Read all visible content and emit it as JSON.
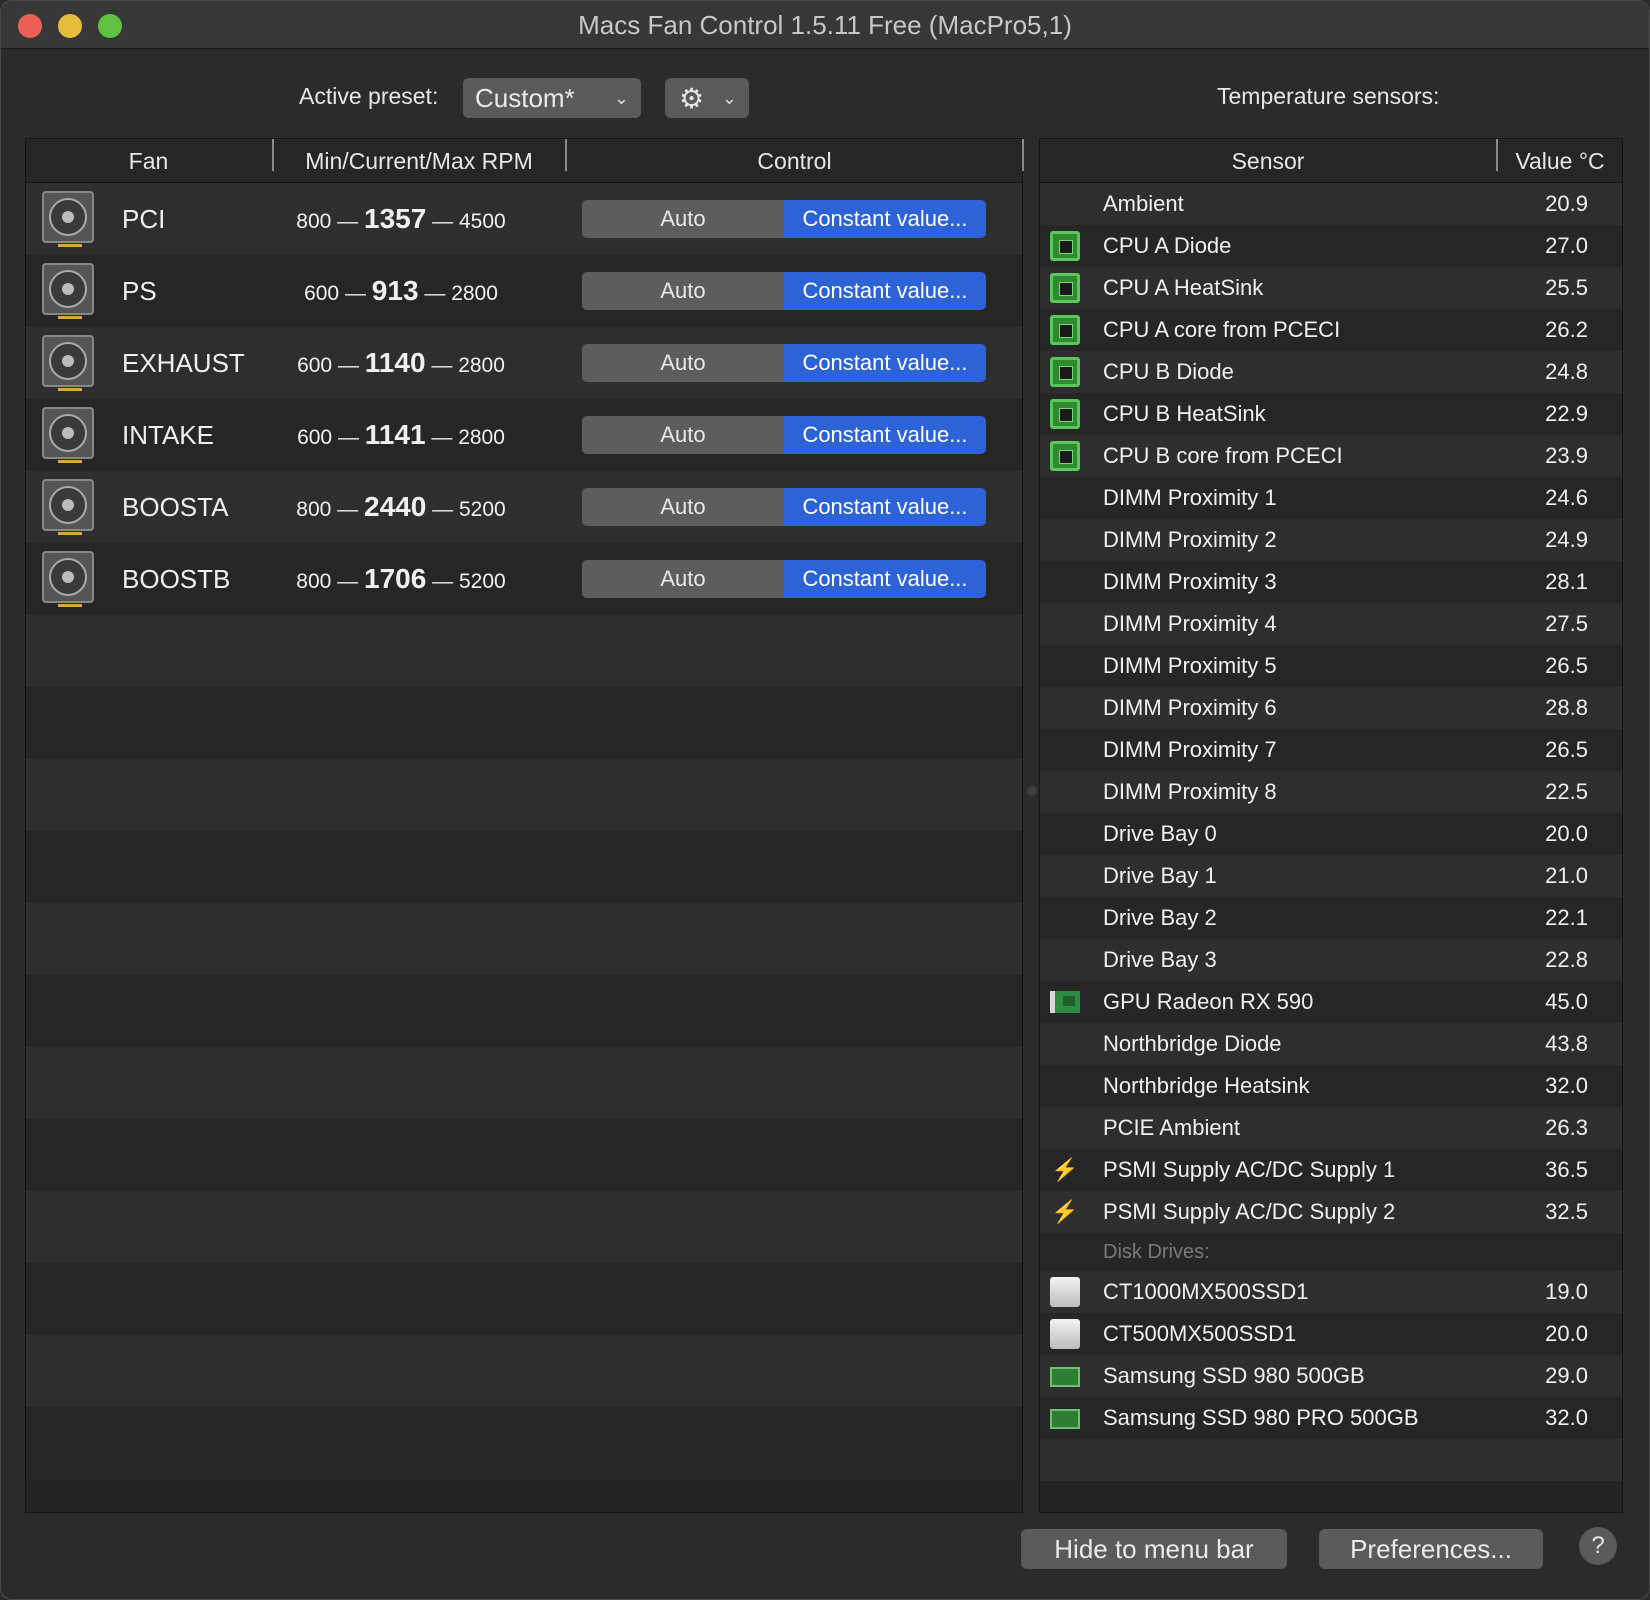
{
  "window": {
    "title": "Macs Fan Control 1.5.11 Free (MacPro5,1)"
  },
  "toolbar": {
    "preset_label": "Active preset:",
    "preset_value": "Custom*",
    "temperature_title": "Temperature sensors:"
  },
  "fans": {
    "headers": {
      "fan": "Fan",
      "rpm": "Min/Current/Max RPM",
      "control": "Control"
    },
    "rows": [
      {
        "name": "PCI",
        "min": "800",
        "current": "1357",
        "max": "4500",
        "auto": "Auto",
        "constant": "Constant value..."
      },
      {
        "name": "PS",
        "min": "600",
        "current": "913",
        "max": "2800",
        "auto": "Auto",
        "constant": "Constant value..."
      },
      {
        "name": "EXHAUST",
        "min": "600",
        "current": "1140",
        "max": "2800",
        "auto": "Auto",
        "constant": "Constant value..."
      },
      {
        "name": "INTAKE",
        "min": "600",
        "current": "1141",
        "max": "2800",
        "auto": "Auto",
        "constant": "Constant value..."
      },
      {
        "name": "BOOSTA",
        "min": "800",
        "current": "2440",
        "max": "5200",
        "auto": "Auto",
        "constant": "Constant value..."
      },
      {
        "name": "BOOSTB",
        "min": "800",
        "current": "1706",
        "max": "5200",
        "auto": "Auto",
        "constant": "Constant value..."
      }
    ]
  },
  "sensors": {
    "headers": {
      "sensor": "Sensor",
      "value": "Value °C"
    },
    "rows": [
      {
        "name": "Ambient",
        "value": "20.9",
        "icon": "none"
      },
      {
        "name": "CPU A Diode",
        "value": "27.0",
        "icon": "cpu"
      },
      {
        "name": "CPU A HeatSink",
        "value": "25.5",
        "icon": "cpu"
      },
      {
        "name": "CPU A core from PCECI",
        "value": "26.2",
        "icon": "cpu"
      },
      {
        "name": "CPU B Diode",
        "value": "24.8",
        "icon": "cpu"
      },
      {
        "name": "CPU B HeatSink",
        "value": "22.9",
        "icon": "cpu"
      },
      {
        "name": "CPU B core from PCECI",
        "value": "23.9",
        "icon": "cpu"
      },
      {
        "name": "DIMM Proximity 1",
        "value": "24.6",
        "icon": "none"
      },
      {
        "name": "DIMM Proximity 2",
        "value": "24.9",
        "icon": "none"
      },
      {
        "name": "DIMM Proximity 3",
        "value": "28.1",
        "icon": "none"
      },
      {
        "name": "DIMM Proximity 4",
        "value": "27.5",
        "icon": "none"
      },
      {
        "name": "DIMM Proximity 5",
        "value": "26.5",
        "icon": "none"
      },
      {
        "name": "DIMM Proximity 6",
        "value": "28.8",
        "icon": "none"
      },
      {
        "name": "DIMM Proximity 7",
        "value": "26.5",
        "icon": "none"
      },
      {
        "name": "DIMM Proximity 8",
        "value": "22.5",
        "icon": "none"
      },
      {
        "name": "Drive Bay 0",
        "value": "20.0",
        "icon": "none"
      },
      {
        "name": "Drive Bay 1",
        "value": "21.0",
        "icon": "none"
      },
      {
        "name": "Drive Bay 2",
        "value": "22.1",
        "icon": "none"
      },
      {
        "name": "Drive Bay 3",
        "value": "22.8",
        "icon": "none"
      },
      {
        "name": "GPU Radeon RX 590",
        "value": "45.0",
        "icon": "gpu"
      },
      {
        "name": "Northbridge Diode",
        "value": "43.8",
        "icon": "none"
      },
      {
        "name": "Northbridge Heatsink",
        "value": "32.0",
        "icon": "none"
      },
      {
        "name": "PCIE Ambient",
        "value": "26.3",
        "icon": "none"
      },
      {
        "name": "PSMI Supply AC/DC Supply 1",
        "value": "36.5",
        "icon": "bolt"
      },
      {
        "name": "PSMI Supply AC/DC Supply 2",
        "value": "32.5",
        "icon": "bolt"
      }
    ],
    "disk_section_label": "Disk Drives:",
    "disks": [
      {
        "name": "CT1000MX500SSD1",
        "value": "19.0",
        "icon": "disk"
      },
      {
        "name": "CT500MX500SSD1",
        "value": "20.0",
        "icon": "disk"
      },
      {
        "name": "Samsung SSD 980 500GB",
        "value": "29.0",
        "icon": "ssd"
      },
      {
        "name": "Samsung SSD 980 PRO 500GB",
        "value": "32.0",
        "icon": "ssd"
      }
    ]
  },
  "footer": {
    "hide_label": "Hide to menu bar",
    "preferences_label": "Preferences...",
    "help_label": "?"
  },
  "colors": {
    "accent": "#2e63d8",
    "background": "#2b2b2b"
  }
}
